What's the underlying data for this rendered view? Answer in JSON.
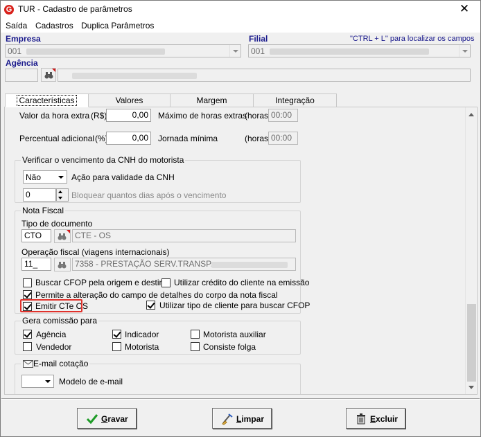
{
  "window": {
    "title": "TUR - Cadastro de parâmetros",
    "close_glyph": "✕",
    "logo_letter": "G"
  },
  "menu": [
    "Saída",
    "Cadastros",
    "Duplica Parâmetros"
  ],
  "header": {
    "empresa_label": "Empresa",
    "empresa_value": "001",
    "filial_label": "Filial",
    "filial_value": "001",
    "hint": "\"CTRL + L\" para localizar os campos",
    "agencia_label": "Agência"
  },
  "tabs": [
    {
      "label": "Características",
      "active": true
    },
    {
      "label": "Valores",
      "active": false
    },
    {
      "label": "Margem",
      "active": false
    },
    {
      "label": "Integração",
      "active": false
    }
  ],
  "horas_extra": {
    "valor_label": "Valor da hora extra",
    "valor_unit": "(R$)",
    "valor_value": "0,00",
    "max_label": "Máximo de horas extras",
    "max_unit": "(horas)",
    "max_value": "00:00",
    "perc_label": "Percentual adicional",
    "perc_unit": "(%)",
    "perc_value": "0,00",
    "jornada_label": "Jornada mínima",
    "jornada_unit": "(horas)",
    "jornada_value": "00:00"
  },
  "cnh": {
    "title": "Verificar o vencimento da CNH do motorista",
    "acao_value": "Não",
    "acao_label": "Ação para validade da CNH",
    "dias_value": "0",
    "dias_label": "Bloquear quantos dias após o vencimento"
  },
  "nota_fiscal": {
    "title": "Nota Fiscal",
    "tipo_doc_label": "Tipo de documento",
    "tipo_doc_code": "CTO",
    "tipo_doc_desc": "CTE - OS",
    "operacao_label": "Operação fiscal (viagens internacionais)",
    "operacao_code": "11_",
    "operacao_desc": "7358 - PRESTAÇÃO SERV.TRANSP.",
    "chk_buscar_cfop": {
      "label": "Buscar CFOP pela origem e destino",
      "checked": false
    },
    "chk_credito": {
      "label": "Utilizar crédito do cliente na emissão",
      "checked": false
    },
    "chk_permite": {
      "label": "Permite a alteração do campo de detalhes do corpo da nota fiscal",
      "checked": true
    },
    "chk_emitir": {
      "label": "Emitir CTe OS",
      "checked": true
    },
    "chk_tipo_cliente": {
      "label": "Utilizar tipo de cliente para buscar CFOP",
      "checked": true
    }
  },
  "comissao": {
    "title": "Gera comissão para",
    "items": [
      {
        "label": "Agência",
        "checked": true
      },
      {
        "label": "Indicador",
        "checked": true
      },
      {
        "label": "Motorista auxiliar",
        "checked": false
      },
      {
        "label": "Vendedor",
        "checked": false
      },
      {
        "label": "Motorista",
        "checked": false
      },
      {
        "label": "Consiste folga",
        "checked": false
      }
    ]
  },
  "email": {
    "title": "E-mail cotação",
    "modelo_label": "Modelo de e-mail",
    "modelo_value": ""
  },
  "footer": {
    "gravar_label": "Gravar",
    "limpar_label": "Limpar",
    "excluir_label": "Excluir"
  },
  "colors": {
    "highlight": "#e0322c",
    "label_blue": "#1a1a8c",
    "check_green": "#1d9b26"
  }
}
